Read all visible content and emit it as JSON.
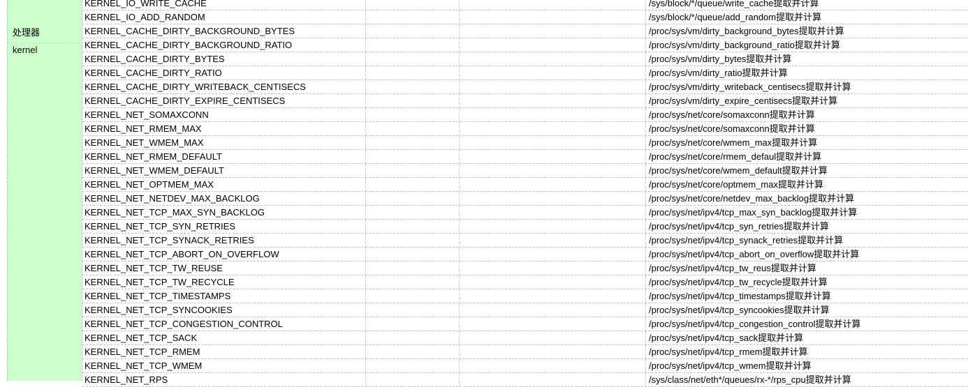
{
  "document": {
    "type": "spreadsheet-table",
    "grid_line_style": "dashed",
    "grid_line_color": "#c0c0c0",
    "category_fill_color": "#ccffcc",
    "text_color": "#000000",
    "background_color": "#ffffff"
  },
  "category_column": {
    "cells": [
      {
        "label": "处理器"
      },
      {
        "label": "kernel"
      }
    ]
  },
  "columns": {
    "headers": [
      "",
      "",
      "",
      ""
    ],
    "widths": [
      406,
      134,
      267,
      461
    ]
  },
  "rows": [
    {
      "key": "KERNEL_IO_WRITE_CACHE",
      "col_b": "",
      "col_c": "",
      "path": "/sys/block/*/queue/write_cache提取并计算",
      "clipped_top": true
    },
    {
      "key": "KERNEL_IO_ADD_RANDOM",
      "col_b": "",
      "col_c": "",
      "path": "/sys/block/*/queue/add_random提取并计算"
    },
    {
      "key": "KERNEL_CACHE_DIRTY_BACKGROUND_BYTES",
      "col_b": "",
      "col_c": "",
      "path": "/proc/sys/vm/dirty_background_bytes提取并计算"
    },
    {
      "key": "KERNEL_CACHE_DIRTY_BACKGROUND_RATIO",
      "col_b": "",
      "col_c": "",
      "path": "/proc/sys/vm/dirty_background_ratio提取并计算"
    },
    {
      "key": "KERNEL_CACHE_DIRTY_BYTES",
      "col_b": "",
      "col_c": "",
      "path": "/proc/sys/vm/dirty_bytes提取并计算"
    },
    {
      "key": "KERNEL_CACHE_DIRTY_RATIO",
      "col_b": "",
      "col_c": "",
      "path": "/proc/sys/vm/dirty_ratio提取并计算"
    },
    {
      "key": "KERNEL_CACHE_DIRTY_WRITEBACK_CENTISECS",
      "col_b": "",
      "col_c": "",
      "path": "/proc/sys/vm/dirty_writeback_centisecs提取并计算"
    },
    {
      "key": "KERNEL_CACHE_DIRTY_EXPIRE_CENTISECS",
      "col_b": "",
      "col_c": "",
      "path": "/proc/sys/vm/dirty_expire_centisecs提取并计算"
    },
    {
      "key": "KERNEL_NET_SOMAXCONN",
      "col_b": "",
      "col_c": "",
      "path": "/proc/sys/net/core/somaxconn提取并计算"
    },
    {
      "key": "KERNEL_NET_RMEM_MAX",
      "col_b": "",
      "col_c": "",
      "path": "/proc/sys/net/core/somaxconn提取并计算"
    },
    {
      "key": "KERNEL_NET_WMEM_MAX",
      "col_b": "",
      "col_c": "",
      "path": "/proc/sys/net/core/wmem_max提取并计算"
    },
    {
      "key": "KERNEL_NET_RMEM_DEFAULT",
      "col_b": "",
      "col_c": "",
      "path": "/proc/sys/net/core/rmem_defaul提取并计算"
    },
    {
      "key": "KERNEL_NET_WMEM_DEFAULT",
      "col_b": "",
      "col_c": "",
      "path": "/proc/sys/net/core/wmem_default提取并计算"
    },
    {
      "key": "KERNEL_NET_OPTMEM_MAX",
      "col_b": "",
      "col_c": "",
      "path": "/proc/sys/net/core/optmem_max提取并计算"
    },
    {
      "key": "KERNEL_NET_NETDEV_MAX_BACKLOG",
      "col_b": "",
      "col_c": "",
      "path": "/proc/sys/net/core/netdev_max_backlog提取并计算"
    },
    {
      "key": "KERNEL_NET_TCP_MAX_SYN_BACKLOG",
      "col_b": "",
      "col_c": "",
      "path": "/proc/sys/net/ipv4/tcp_max_syn_backlog提取并计算"
    },
    {
      "key": "KERNEL_NET_TCP_SYN_RETRIES",
      "col_b": "",
      "col_c": "",
      "path": "/proc/sys/net/ipv4/tcp_syn_retries提取并计算"
    },
    {
      "key": "KERNEL_NET_TCP_SYNACK_RETRIES",
      "col_b": "",
      "col_c": "",
      "path": "/proc/sys/net/ipv4/tcp_synack_retries提取并计算"
    },
    {
      "key": "KERNEL_NET_TCP_ABORT_ON_OVERFLOW",
      "col_b": "",
      "col_c": "",
      "path": "/proc/sys/net/ipv4/tcp_abort_on_overflow提取并计算"
    },
    {
      "key": "KERNEL_NET_TCP_TW_REUSE",
      "col_b": "",
      "col_c": "",
      "path": "/proc/sys/net/ipv4/tcp_tw_reus提取并计算"
    },
    {
      "key": "KERNEL_NET_TCP_TW_RECYCLE",
      "col_b": "",
      "col_c": "",
      "path": "/proc/sys/net/ipv4/tcp_tw_recycle提取并计算"
    },
    {
      "key": "KERNEL_NET_TCP_TIMESTAMPS",
      "col_b": "",
      "col_c": "",
      "path": "/proc/sys/net/ipv4/tcp_timestamps提取并计算"
    },
    {
      "key": "KERNEL_NET_TCP_SYNCOOKIES",
      "col_b": "",
      "col_c": "",
      "path": "/proc/sys/net/ipv4/tcp_syncookies提取并计算"
    },
    {
      "key": "KERNEL_NET_TCP_CONGESTION_CONTROL",
      "col_b": "",
      "col_c": "",
      "path": "/proc/sys/net/ipv4/tcp_congestion_control提取并计算"
    },
    {
      "key": "KERNEL_NET_TCP_SACK",
      "col_b": "",
      "col_c": "",
      "path": "/proc/sys/net/ipv4/tcp_sack提取并计算"
    },
    {
      "key": "KERNEL_NET_TCP_RMEM",
      "col_b": "",
      "col_c": "",
      "path": "/proc/sys/net/ipv4/tcp_rmem提取并计算"
    },
    {
      "key": "KERNEL_NET_TCP_WMEM",
      "col_b": "",
      "col_c": "",
      "path": "/proc/sys/net/ipv4/tcp_wmem提取并计算"
    },
    {
      "key": "KERNEL_NET_RPS",
      "col_b": "",
      "col_c": "",
      "path": "/sys/class/net/eth*/queues/rx-*/rps_cpu提取并计算"
    }
  ]
}
